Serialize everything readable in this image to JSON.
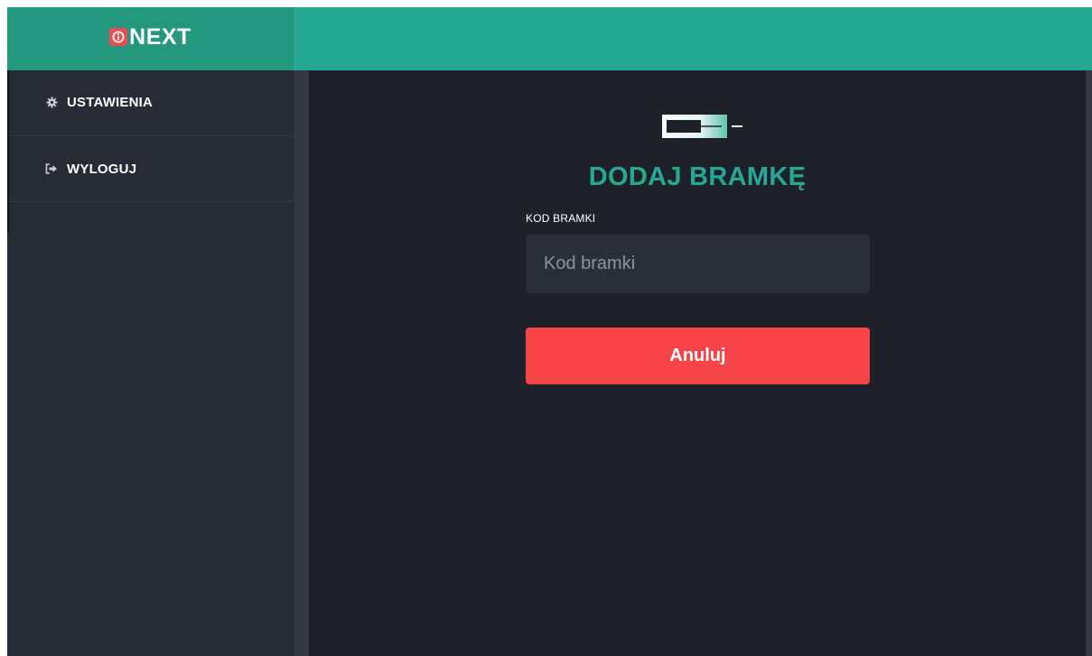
{
  "header": {
    "logo_text": "NEXT",
    "logo_icon": "info-badge-icon",
    "colors": {
      "header": "#26a893",
      "logo_area": "#24977f",
      "badge": "#ef4b50"
    }
  },
  "sidebar": {
    "items": [
      {
        "label": "USTAWIENIA",
        "icon": "gear-icon"
      },
      {
        "label": "WYLOGUJ",
        "icon": "logout-icon"
      }
    ]
  },
  "main": {
    "icon": "gateway-device-icon",
    "title": "DODAJ BRAMKĘ",
    "field_label": "KOD BRAMKI",
    "input_placeholder": "Kod bramki",
    "input_value": "",
    "cancel_label": "Anuluj",
    "colors": {
      "title": "#26a893",
      "cancel": "#f74449",
      "background": "#1e2129"
    }
  }
}
